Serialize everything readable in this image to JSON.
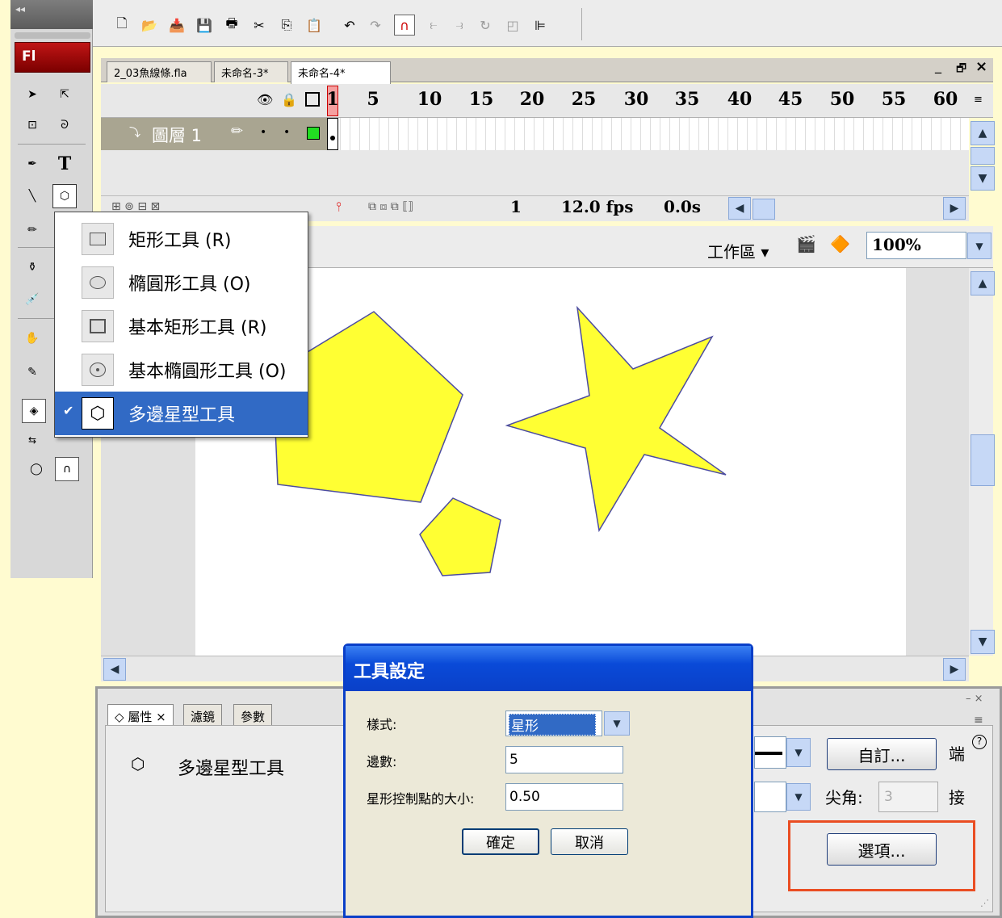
{
  "toolbar_labels": {
    "collapse": "◂◂",
    "logo": "Fl"
  },
  "doc_tabs": [
    "2_03魚線條.fla",
    "未命名-3*",
    "未命名-4*"
  ],
  "window_controls": {
    "minimize": "_",
    "restore": "🗗",
    "close": "×"
  },
  "timeline": {
    "frame_numbers": [
      "1",
      "5",
      "10",
      "15",
      "20",
      "25",
      "30",
      "35",
      "40",
      "45",
      "50",
      "55",
      "60"
    ],
    "layer_name": "圖層 1",
    "current_frame": "1",
    "fps": "12.0 fps",
    "time": "0.0s"
  },
  "editbar": {
    "workspace": "工作區",
    "zoom": "100%"
  },
  "tool_menu": {
    "items": [
      {
        "label": "矩形工具 (R)",
        "icon": "rect-icon"
      },
      {
        "label": "橢圓形工具 (O)",
        "icon": "ellipse-icon"
      },
      {
        "label": "基本矩形工具 (R)",
        "icon": "primitive-rect-icon"
      },
      {
        "label": "基本橢圓形工具 (O)",
        "icon": "primitive-ellipse-icon"
      },
      {
        "label": "多邊星型工具",
        "icon": "polystar-icon",
        "checked": true
      }
    ]
  },
  "properties": {
    "tabs": [
      "屬性",
      "濾鏡",
      "參數"
    ],
    "tab_close": "×",
    "tool_name": "多邊星型工具",
    "custom_btn": "自訂...",
    "cap_label": "端",
    "join_label": "接",
    "miter_label": "尖角:",
    "miter_value": "3",
    "options_btn": "選項...",
    "help": "?"
  },
  "dialog": {
    "title": "工具設定",
    "style_label": "樣式:",
    "style_value": "星形",
    "sides_label": "邊數:",
    "sides_value": "5",
    "point_label": "星形控制點的大小:",
    "point_value": "0.50",
    "ok": "確定",
    "cancel": "取消"
  },
  "colors": {
    "fill": "#ffff33",
    "stroke": "#4c4ca0",
    "highlight": "#ea4d22",
    "menu_select": "#316ac5"
  }
}
